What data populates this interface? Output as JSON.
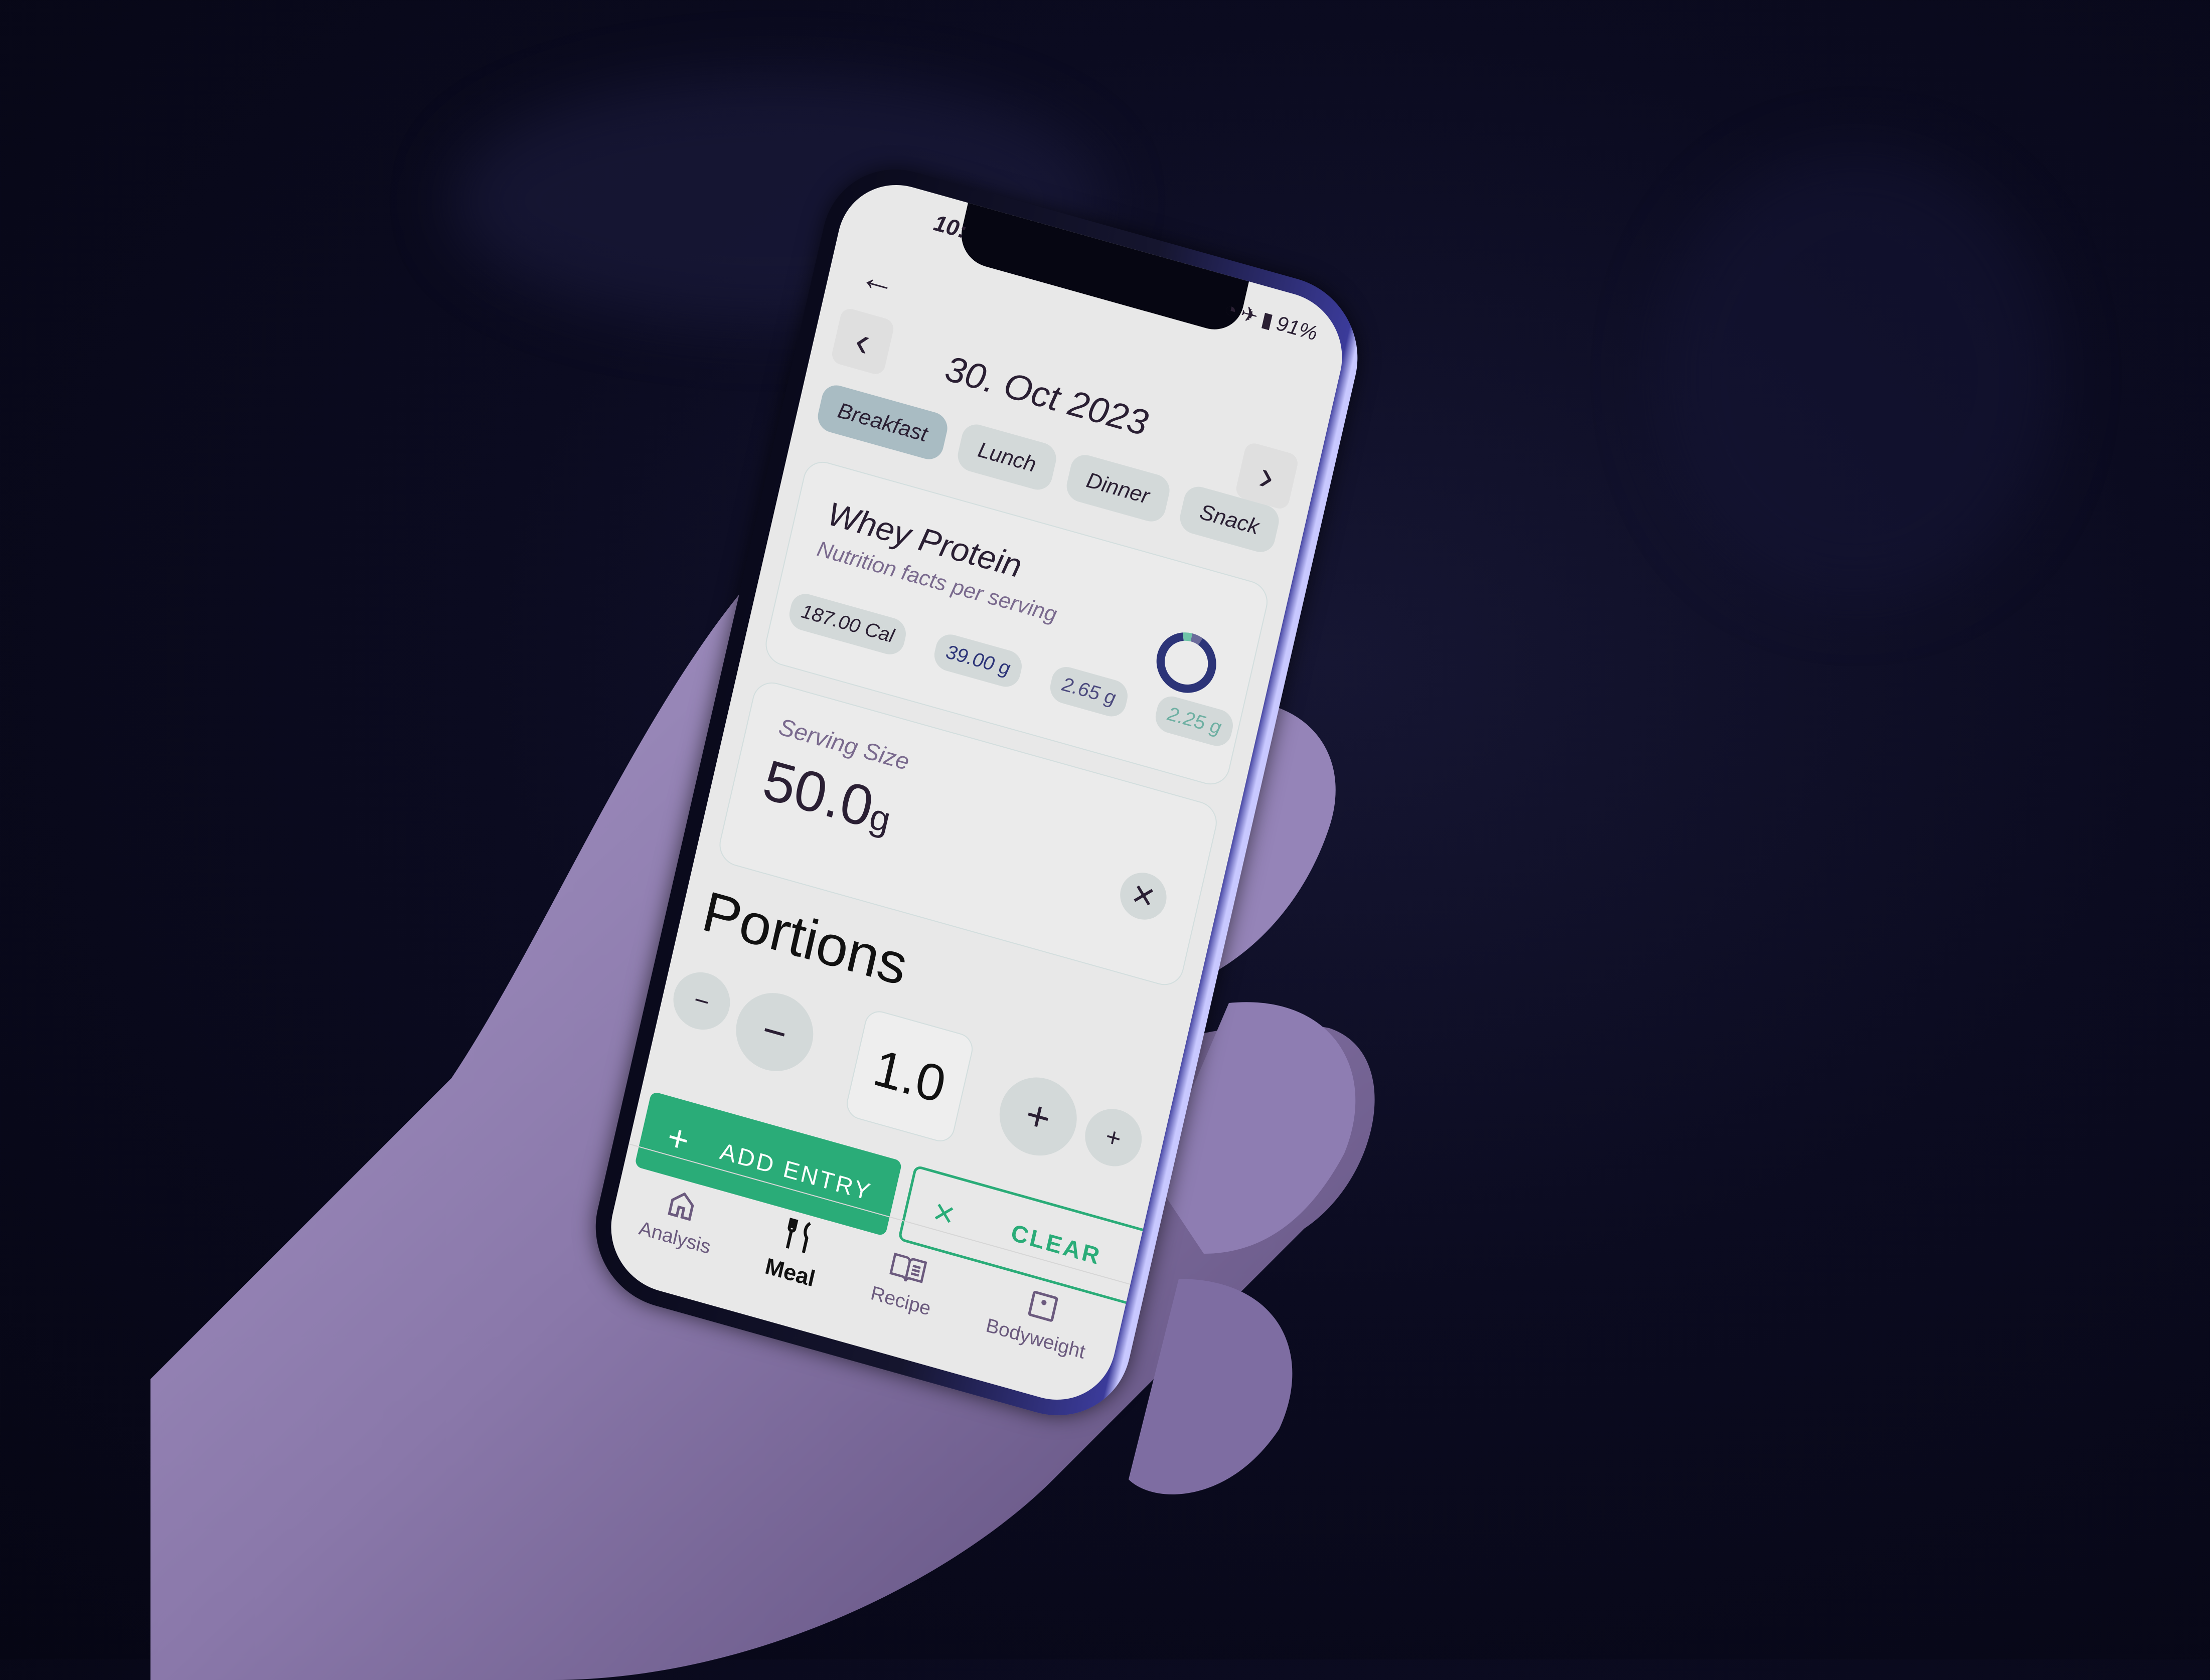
{
  "status_bar": {
    "time": "10:",
    "battery": "91%",
    "icons": [
      "alarm-icon",
      "airplane-icon",
      "battery-icon"
    ]
  },
  "header": {
    "back_icon": "arrow-left-icon",
    "date": "30. Oct 2023",
    "prev_icon": "chevron-left-icon",
    "next_icon": "chevron-right-icon"
  },
  "meal_tabs": [
    {
      "label": "Breakfast",
      "active": true
    },
    {
      "label": "Lunch",
      "active": false
    },
    {
      "label": "Dinner",
      "active": false
    },
    {
      "label": "Snack",
      "active": false
    }
  ],
  "food": {
    "name": "Whey Protein",
    "subtitle": "Nutrition facts per serving",
    "calories": "187.00 Cal",
    "protein": "39.00 g",
    "carbs": "2.65 g",
    "fat": "2.25 g",
    "macro_chart": {
      "protein_g": 39.0,
      "carbs_g": 2.65,
      "fat_g": 2.25,
      "colors": {
        "protein": "#2c3478",
        "carbs": "#6a6a9a",
        "fat": "#6fc4a8"
      }
    }
  },
  "serving": {
    "label": "Serving Size",
    "value": "50.0",
    "unit": "g",
    "clear_icon": "close-icon"
  },
  "portions": {
    "title": "Portions",
    "value": "1.0",
    "decrement_small": "−",
    "decrement_large": "−",
    "increment_large": "+",
    "increment_small": "+"
  },
  "actions": {
    "add_label": "ADD ENTRY",
    "add_icon": "+",
    "clear_label": "CLEAR",
    "clear_icon": "×",
    "accent": "#2aac78"
  },
  "bottom_nav": [
    {
      "label": "Analysis",
      "icon": "home-icon",
      "active": false
    },
    {
      "label": "Meal",
      "icon": "fork-knife-icon",
      "active": true
    },
    {
      "label": "Recipe",
      "icon": "book-icon",
      "active": false
    },
    {
      "label": "Bodyweight",
      "icon": "scale-icon",
      "active": false
    }
  ]
}
